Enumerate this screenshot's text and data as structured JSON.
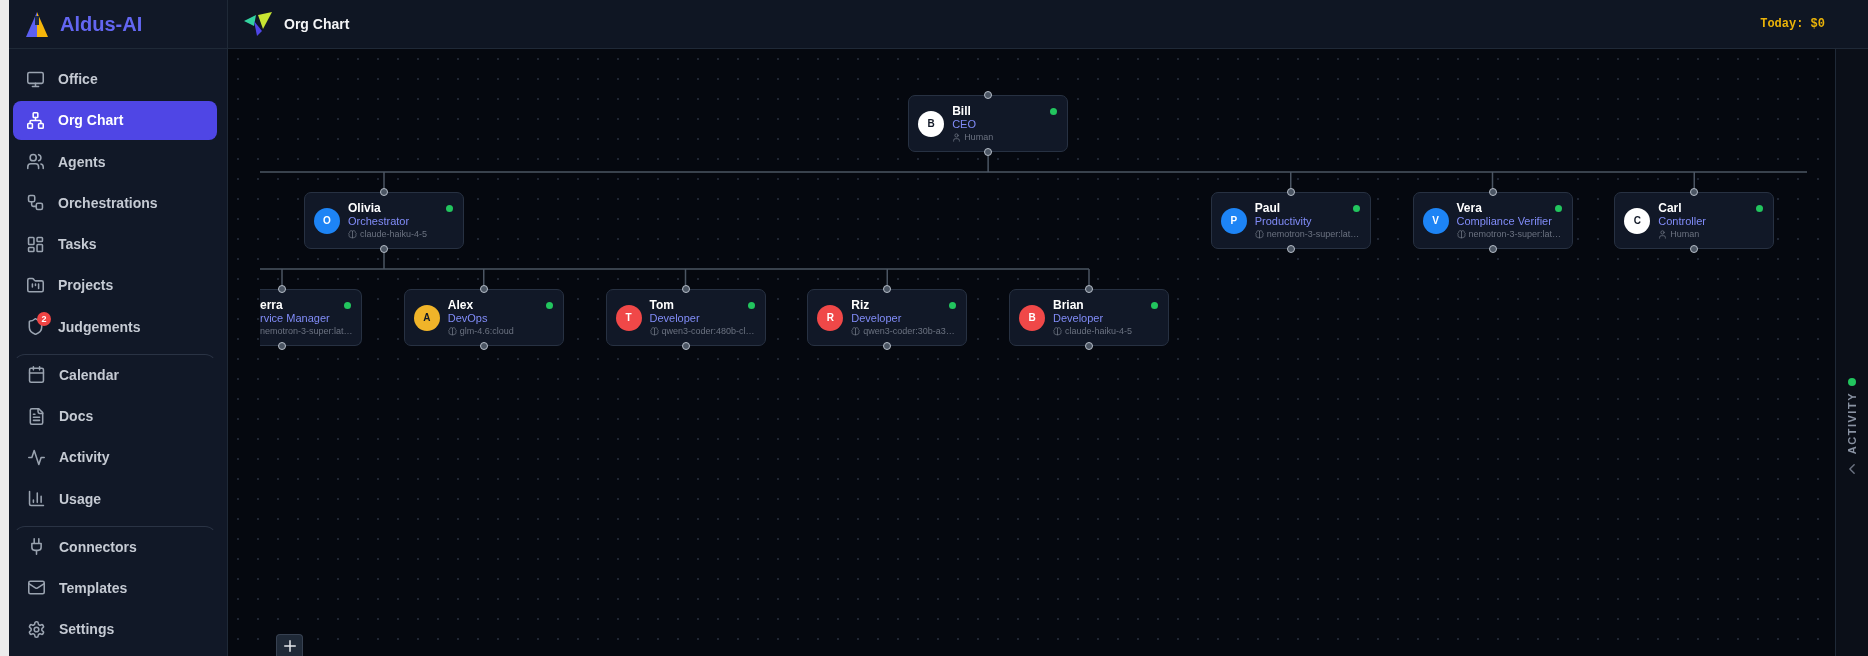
{
  "sidebar": {
    "brand": "Aldus-AI",
    "sections": [
      {
        "items": [
          {
            "label": "Office",
            "selected": false
          },
          {
            "label": "Org Chart",
            "selected": true
          },
          {
            "label": "Agents",
            "selected": false
          },
          {
            "label": "Orchestrations",
            "selected": false
          },
          {
            "label": "Tasks",
            "selected": false
          },
          {
            "label": "Projects",
            "selected": false
          },
          {
            "label": "Judgements",
            "selected": false,
            "badge": "2"
          }
        ]
      },
      {
        "items": [
          {
            "label": "Calendar",
            "selected": false
          },
          {
            "label": "Docs",
            "selected": false
          },
          {
            "label": "Activity",
            "selected": false
          },
          {
            "label": "Usage",
            "selected": false
          }
        ]
      },
      {
        "items": [
          {
            "label": "Connectors",
            "selected": false
          },
          {
            "label": "Templates",
            "selected": false
          },
          {
            "label": "Settings",
            "selected": false
          }
        ]
      }
    ]
  },
  "header": {
    "title": "Org Chart",
    "today_cost": "Today: $0"
  },
  "org_chart": {
    "root": {
      "name": "Bill",
      "role": "CEO",
      "kind": "human",
      "model": "Human",
      "avatar": "B",
      "color": "#ffffff",
      "online": true,
      "children": [
        {
          "name": "Olivia",
          "role": "Orchestrator",
          "kind": "agent",
          "model": "claude-haiku-4-5",
          "avatar": "O",
          "color": "#1d84f5",
          "online": true,
          "children": [
            {
              "name": "erra",
              "role": "rvice Manager",
              "model": "nemotron-3-super:lat…",
              "online": true,
              "partial": true
            },
            {
              "name": "Alex",
              "role": "DevOps",
              "kind": "agent",
              "model": "glm-4.6:cloud",
              "avatar": "A",
              "color": "#f0b429",
              "online": true
            },
            {
              "name": "Tom",
              "role": "Developer",
              "kind": "agent",
              "model": "qwen3-coder:480b-cl…",
              "avatar": "T",
              "color": "#f04848",
              "online": true
            },
            {
              "name": "Riz",
              "role": "Developer",
              "kind": "agent",
              "model": "qwen3-coder:30b-a3…",
              "avatar": "R",
              "color": "#f04848",
              "online": true
            },
            {
              "name": "Brian",
              "role": "Developer",
              "kind": "agent",
              "model": "claude-haiku-4-5",
              "avatar": "B",
              "color": "#f04848",
              "online": true
            }
          ]
        },
        {
          "name": "Paul",
          "role": "Productivity",
          "kind": "agent",
          "model": "nemotron-3-super:lat…",
          "avatar": "P",
          "color": "#1d84f5",
          "online": true
        },
        {
          "name": "Vera",
          "role": "Compliance Verifier",
          "kind": "agent",
          "model": "nemotron-3-super:lat…",
          "avatar": "V",
          "color": "#1d84f5",
          "online": true
        },
        {
          "name": "Carl",
          "role": "Controller",
          "kind": "human",
          "model": "Human",
          "avatar": "C",
          "color": "#ffffff",
          "online": true
        }
      ]
    }
  },
  "activity_panel": {
    "label": "ACTIVITY",
    "online": true
  }
}
